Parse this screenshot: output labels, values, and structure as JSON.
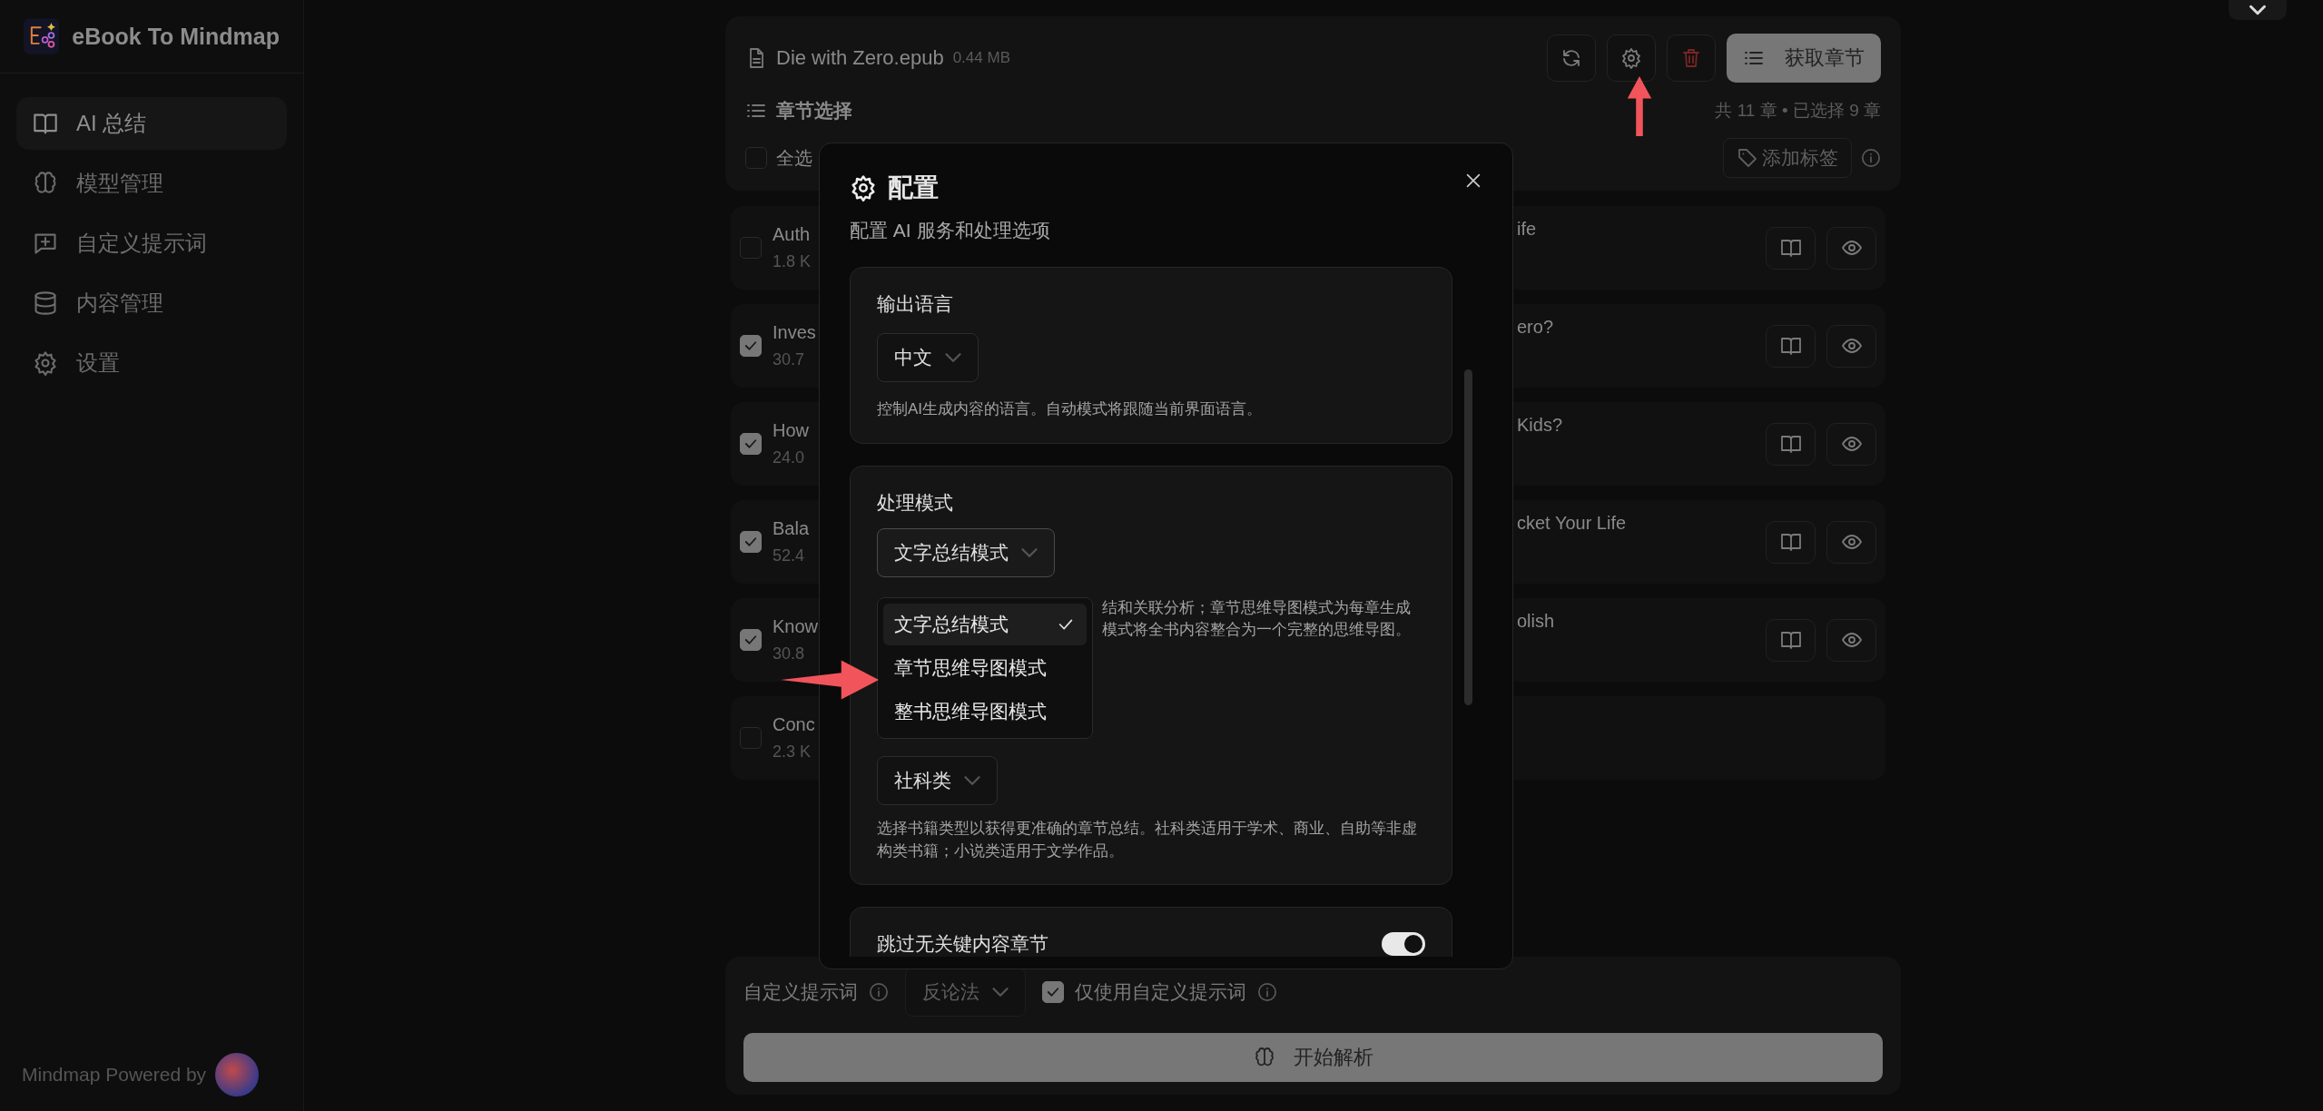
{
  "sidebar": {
    "app_name": "eBook To Mindmap",
    "items": [
      {
        "label": "AI 总结",
        "selected": true
      },
      {
        "label": "模型管理",
        "selected": false
      },
      {
        "label": "自定义提示词",
        "selected": false
      },
      {
        "label": "内容管理",
        "selected": false
      },
      {
        "label": "设置",
        "selected": false
      }
    ],
    "footer": "Mindmap Powered by"
  },
  "file": {
    "name": "Die with Zero.epub",
    "size": "0.44 MB",
    "fetch_button": "获取章节"
  },
  "chapters": {
    "title": "章节选择",
    "summary": "共 11 章 • 已选择 9 章",
    "select_all": {
      "label": "全选",
      "checked": false
    },
    "tag_button": "添加标签",
    "rows": [
      {
        "title_start": "Auth",
        "title_end": "ife",
        "size": "1.8 K",
        "checked": false,
        "actions": true
      },
      {
        "title_start": "Inves",
        "title_end": "ero?",
        "size": "30.7",
        "checked": true,
        "actions": true
      },
      {
        "title_start": "How",
        "title_end": "Kids?",
        "size": "24.0",
        "checked": true,
        "actions": true
      },
      {
        "title_start": "Bala",
        "title_end": "cket Your Life",
        "size": "52.4",
        "checked": true,
        "actions": true
      },
      {
        "title_start": "Know",
        "title_end": "olish",
        "size": "30.8",
        "checked": true,
        "actions": true
      },
      {
        "title_start": "Conc",
        "title_end": "",
        "size": "2.3 K",
        "checked": false,
        "actions": false
      }
    ]
  },
  "bottom": {
    "prompt_label": "自定义提示词",
    "prompt_value": "反论法",
    "only_custom": {
      "label": "仅使用自定义提示词",
      "checked": true
    },
    "start_button": "开始解析"
  },
  "dialog": {
    "title": "配置",
    "subtitle": "配置 AI 服务和处理选项",
    "sections": [
      {
        "kind": "select",
        "label": "输出语言",
        "value": "中文",
        "hint": "控制AI生成内容的语言。自动模式将跟随当前界面语言。"
      },
      {
        "kind": "mode",
        "label": "处理模式",
        "value": "文字总结模式",
        "expanded": true,
        "options": [
          {
            "label": "文字总结模式",
            "selected": true
          },
          {
            "label": "章节思维导图模式",
            "selected": false
          },
          {
            "label": "整书思维导图模式",
            "selected": false
          }
        ],
        "hint_lines": [
          "结和关联分析；章节思维导图模式为每章生成",
          "模式将全书内容整合为一个完整的思维导图。"
        ],
        "book_type": "社科类",
        "book_hint": "选择书籍类型以获得更准确的章节总结。社科类适用于学术、商业、自助等非虚构类书籍；小说类适用于文学作品。"
      },
      {
        "kind": "toggle",
        "label": "跳过无关键内容章节",
        "on": true
      }
    ]
  }
}
